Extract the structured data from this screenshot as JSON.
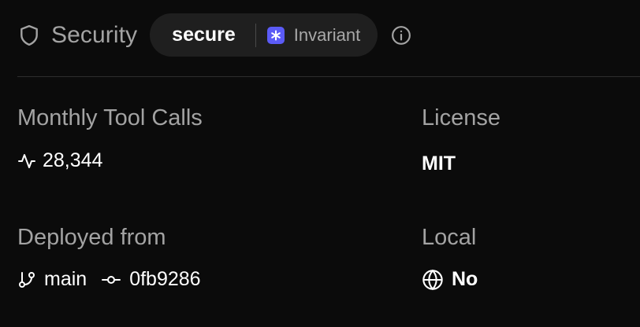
{
  "security": {
    "label": "Security",
    "status": "secure",
    "provider": "Invariant",
    "icon": "shield-icon",
    "info_icon": "info-icon"
  },
  "stats": {
    "monthly_tool_calls": {
      "label": "Monthly Tool Calls",
      "value": "28,344",
      "icon": "activity-icon"
    },
    "license": {
      "label": "License",
      "value": "MIT"
    },
    "deployed_from": {
      "label": "Deployed from",
      "branch": "main",
      "commit": "0fb9286",
      "branch_icon": "git-branch-icon",
      "commit_icon": "git-commit-icon"
    },
    "local": {
      "label": "Local",
      "value": "No",
      "icon": "globe-icon"
    }
  },
  "colors": {
    "background": "#0b0b0b",
    "muted_text": "#a3a3a3",
    "pill_background": "#1f1f1f",
    "invariant_accent": "#5b5bf6"
  }
}
